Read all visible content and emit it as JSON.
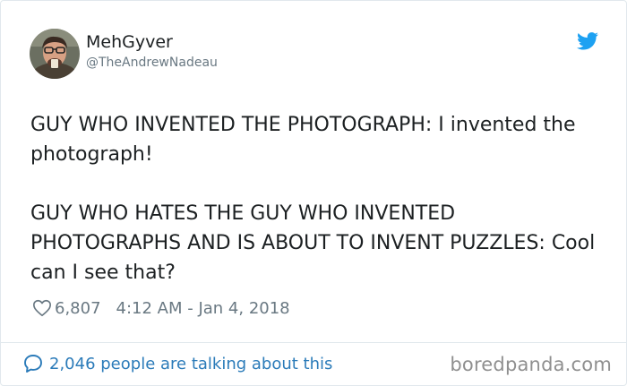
{
  "tweet": {
    "display_name": "MehGyver",
    "handle": "@TheAndrewNadeau",
    "text": "GUY WHO INVENTED THE PHOTOGRAPH: I invented the photograph!\n\nGUY WHO HATES THE GUY WHO INVENTED PHOTOGRAPHS AND IS ABOUT TO INVENT PUZZLES: Cool can I see that?",
    "likes": "6,807",
    "timestamp": "4:12 AM - Jan 4, 2018",
    "talking_count_text": "2,046 people are talking about this"
  },
  "watermark": "boredpanda.com",
  "icons": {
    "avatar": "profile-photo",
    "brand": "twitter-bird-icon",
    "like": "heart-outline-icon",
    "conversation": "speech-bubble-icon"
  },
  "colors": {
    "text": "#1c2022",
    "secondary": "#697882",
    "link": "#2b7bb9",
    "twitter_blue": "#1da1f2",
    "border": "#e1e8ed",
    "watermark": "#8f8f8f"
  }
}
